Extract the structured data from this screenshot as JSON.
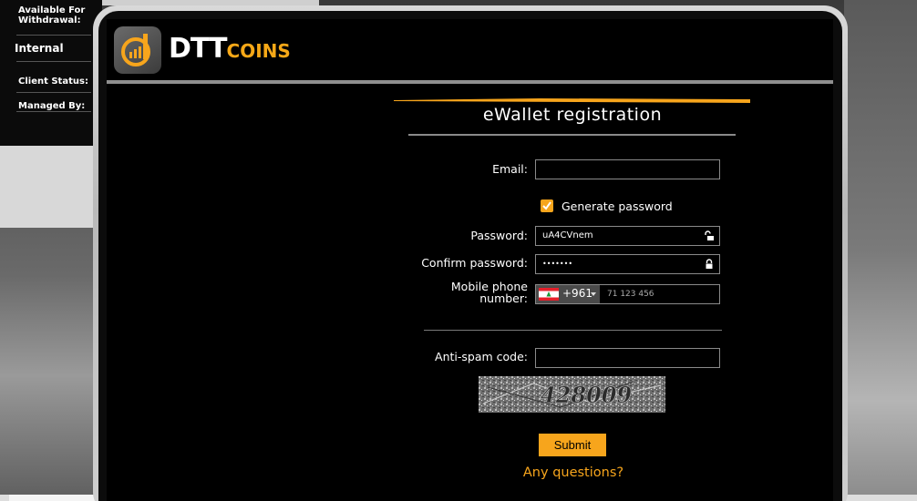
{
  "background_panel": {
    "available_line1": "Available For",
    "available_line2": "Withdrawal:",
    "internal": "Internal",
    "client_status": "Client Status:",
    "managed_by": "Managed By:"
  },
  "brand": {
    "name_big": "DTT",
    "name_small": "COINS",
    "accent_color": "#f7a51c"
  },
  "form": {
    "title": "eWallet registration",
    "email_label": "Email:",
    "email_value": "",
    "generate_password_label": "Generate password",
    "generate_password_checked": true,
    "password_label": "Password:",
    "password_value": "uA4CVnem",
    "confirm_password_label": "Confirm password:",
    "confirm_password_value": "•••••••",
    "mobile_label_line1": "Mobile phone",
    "mobile_label_line2": "number:",
    "dial_code": "+961",
    "phone_placeholder": "71 123 456",
    "antispam_label": "Anti-spam code:",
    "antispam_value": "",
    "captcha_text": "428009",
    "submit_label": "Submit",
    "questions_link": "Any questions?"
  },
  "icons": {
    "logo": "dtt-logo-icon",
    "unlock": "unlock-icon",
    "lock": "lock-icon",
    "check": "checkmark-icon",
    "flag": "lebanon-flag-icon"
  }
}
